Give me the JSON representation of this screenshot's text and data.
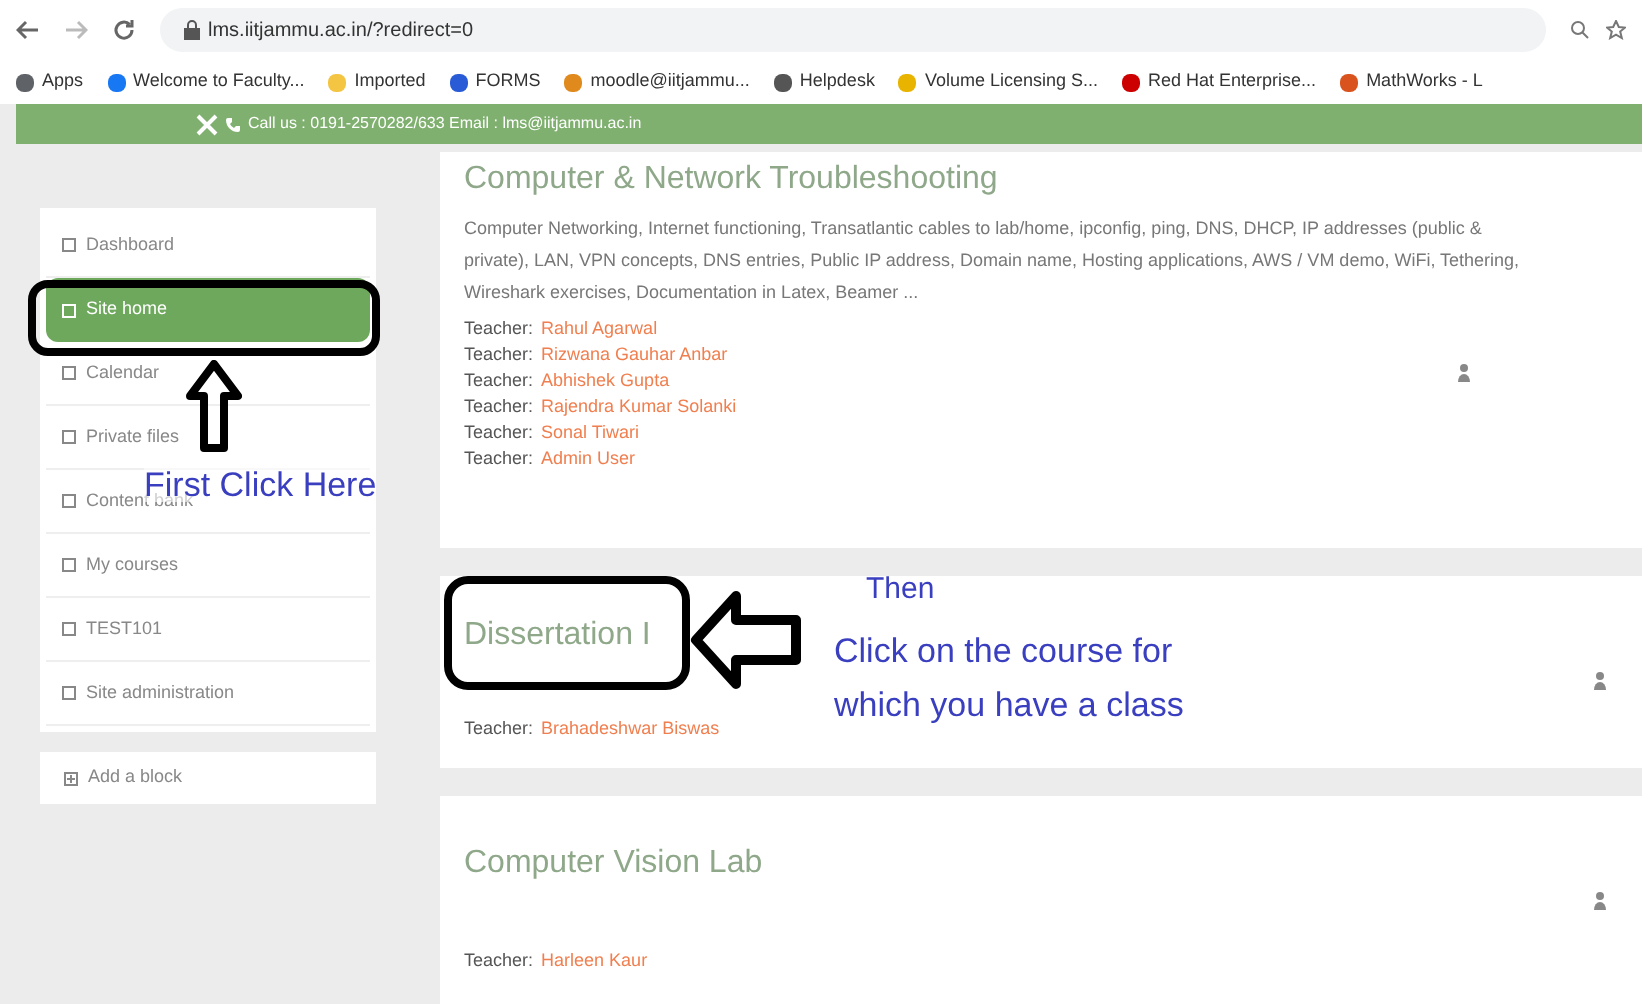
{
  "browser": {
    "url": "lms.iitjammu.ac.in/?redirect=0",
    "bookmarks": [
      {
        "label": "Apps",
        "color": "#5f6368"
      },
      {
        "label": "Welcome to Faculty...",
        "color": "#1877f2"
      },
      {
        "label": "Imported",
        "color": "#f4c542"
      },
      {
        "label": "FORMS",
        "color": "#2a5bd7"
      },
      {
        "label": "moodle@iitjammu...",
        "color": "#e08a1e"
      },
      {
        "label": "Helpdesk",
        "color": "#555555"
      },
      {
        "label": "Volume Licensing S...",
        "color": "#e8b400"
      },
      {
        "label": "Red Hat Enterprise...",
        "color": "#cc0000"
      },
      {
        "label": "MathWorks - L",
        "color": "#d9531e"
      }
    ]
  },
  "top_bar": {
    "contact": "Call us : 0191-2570282/633 Email : lms@iitjammu.ac.in"
  },
  "sidebar": {
    "items": [
      {
        "label": "Dashboard",
        "selected": false
      },
      {
        "label": "Site home",
        "selected": true
      },
      {
        "label": "Calendar",
        "selected": false
      },
      {
        "label": "Private files",
        "selected": false
      },
      {
        "label": "Content bank",
        "selected": false
      },
      {
        "label": "My courses",
        "selected": false
      },
      {
        "label": "TEST101",
        "selected": false
      },
      {
        "label": "Site administration",
        "selected": false
      }
    ],
    "add_block": "Add a block"
  },
  "courses": [
    {
      "title": "Computer & Network Troubleshooting",
      "summary": "Computer Networking, Internet functioning, Transatlantic cables to lab/home, ipconfig, ping, DNS, DHCP, IP addresses (public & private), LAN, VPN concepts, DNS entries, Public IP address, Domain name, Hosting applications, AWS / VM demo, WiFi, Tethering, Wireshark exercises, Documentation in Latex, Beamer ...",
      "teachers": [
        {
          "role": "Teacher:",
          "name": "Rahul Agarwal"
        },
        {
          "role": "Teacher:",
          "name": "Rizwana Gauhar Anbar"
        },
        {
          "role": "Teacher:",
          "name": "Abhishek Gupta"
        },
        {
          "role": "Teacher:",
          "name": "Rajendra Kumar Solanki"
        },
        {
          "role": "Teacher:",
          "name": "Sonal Tiwari"
        },
        {
          "role": "Teacher:",
          "name": "Admin User"
        }
      ]
    },
    {
      "title": "Dissertation I",
      "teachers": [
        {
          "role": "Teacher:",
          "name": "Brahadeshwar Biswas"
        }
      ]
    },
    {
      "title": "Computer Vision Lab",
      "teachers": [
        {
          "role": "Teacher:",
          "name": "Harleen Kaur"
        }
      ]
    }
  ],
  "annotations": {
    "first": "First Click Here",
    "then": "Then",
    "then_detail": [
      "Click on the course for",
      "which you have a class"
    ]
  }
}
